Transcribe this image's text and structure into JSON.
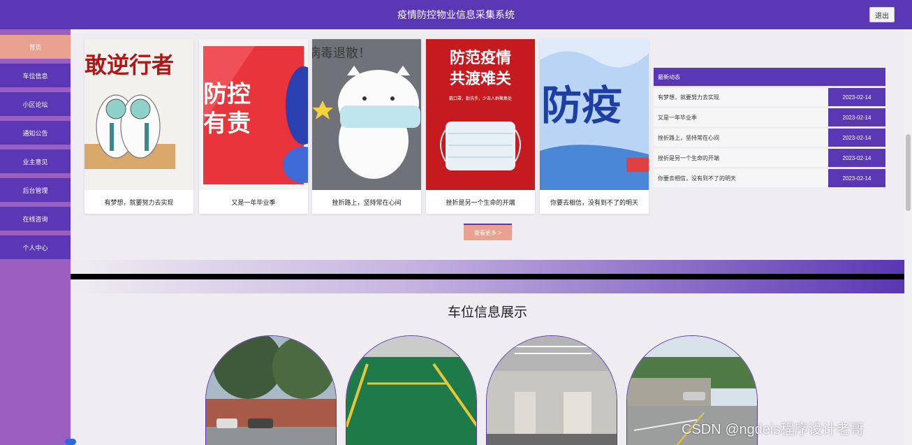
{
  "header": {
    "title": "疫情防控物业信息采集系统",
    "logout_label": "退出"
  },
  "sidebar": {
    "items": [
      {
        "label": "首页",
        "active": true
      },
      {
        "label": "车位信息"
      },
      {
        "label": "小区论坛"
      },
      {
        "label": "通知公告"
      },
      {
        "label": "业主意见"
      },
      {
        "label": "后台管理"
      },
      {
        "label": "在线咨询"
      },
      {
        "label": "个人中心"
      }
    ]
  },
  "gallery": {
    "cards": [
      {
        "caption": "有梦想，就要努力去实现",
        "image_text": "敢逆行者"
      },
      {
        "caption": "又是一年毕业季",
        "image_text": "防控\n有责"
      },
      {
        "caption": "挫折路上，坚持常在心间",
        "image_text": "病毒退散！"
      },
      {
        "caption": "挫折是另一个生命的开端",
        "image_text": "防范疫情\n共渡难关",
        "image_subtext": "戴口罩，勤洗手，少去人群聚集处"
      },
      {
        "caption": "你要去相信，没有到不了的明天",
        "image_text": "防疫"
      }
    ],
    "more_label": "查看更多 >"
  },
  "news": {
    "title": "最新动态",
    "items": [
      {
        "title": "有梦想，就要努力去实现",
        "date": "2023-02-14"
      },
      {
        "title": "又是一年毕业季",
        "date": "2023-02-14"
      },
      {
        "title": "挫折路上，坚持常在心间",
        "date": "2023-02-14"
      },
      {
        "title": "挫折是另一个生命的开端",
        "date": "2023-02-14"
      },
      {
        "title": "你要去相信，没有到不了的明天",
        "date": "2023-02-14"
      }
    ]
  },
  "parking": {
    "title": "车位信息展示"
  },
  "watermark": "CSDN @ngdeis程序设计老哥",
  "colors": {
    "primary": "#5a37b4",
    "accent": "#e8a28f",
    "sidebar_bg": "#9a5fc0"
  }
}
